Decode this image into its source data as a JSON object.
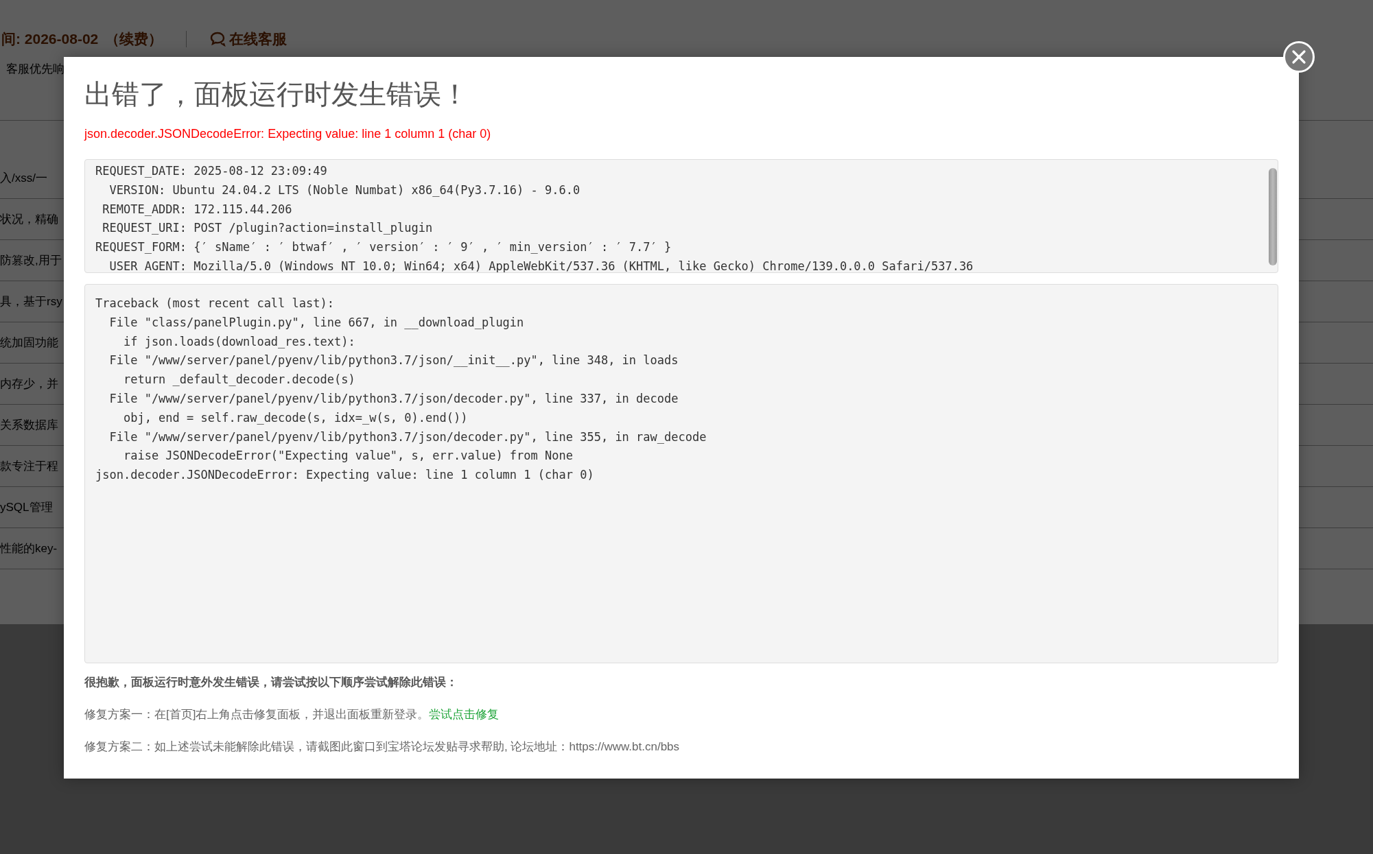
{
  "background_page": {
    "expiry_text": "间: 2026-08-02",
    "renew_link": "（续费）",
    "support_link": "在线客服",
    "notice": "客服优先响",
    "plugin_descriptions": [
      "入/xss/一",
      "状况，精确",
      "防篡改,用于",
      "具，基于rsy",
      "统加固功能",
      "内存少，并",
      "关系数据库",
      "款专注于程",
      "ySQL管理",
      "性能的key-"
    ]
  },
  "dialog": {
    "title": "出错了，面板运行时发生错误！",
    "error_message": "json.decoder.JSONDecodeError: Expecting value: line 1 column 1 (char 0)",
    "request_info": [
      "REQUEST_DATE: 2025-08-12 23:09:49",
      "  VERSION: Ubuntu 24.04.2 LTS (Noble Numbat) x86_64(Py3.7.16) - 9.6.0",
      " REMOTE_ADDR: 172.115.44.206",
      " REQUEST_URI: POST /plugin?action=install_plugin",
      "REQUEST_FORM: {′ sName′ : ′ btwaf′ , ′ version′ : ′ 9′ , ′ min_version′ : ′ 7.7′ }",
      "  USER_AGENT: Mozilla/5.0 (Windows NT 10.0; Win64; x64) AppleWebKit/537.36 (KHTML, like Gecko) Chrome/139.0.0.0 Safari/537.36"
    ],
    "traceback": [
      "Traceback (most recent call last):",
      "  File \"class/panelPlugin.py\", line 667, in __download_plugin",
      "    if json.loads(download_res.text):",
      "  File \"/www/server/panel/pyenv/lib/python3.7/json/__init__.py\", line 348, in loads",
      "    return _default_decoder.decode(s)",
      "  File \"/www/server/panel/pyenv/lib/python3.7/json/decoder.py\", line 337, in decode",
      "    obj, end = self.raw_decode(s, idx=_w(s, 0).end())",
      "  File \"/www/server/panel/pyenv/lib/python3.7/json/decoder.py\", line 355, in raw_decode",
      "    raise JSONDecodeError(\"Expecting value\", s, err.value) from None",
      "json.decoder.JSONDecodeError: Expecting value: line 1 column 1 (char 0)"
    ],
    "help_heading": "很抱歉，面板运行时意外发生错误，请尝试按以下顺序尝试解除此错误：",
    "fix_steps": [
      {
        "text": "修复方案一：在[首页]右上角点击修复面板，并退出面板重新登录。",
        "link": "尝试点击修复"
      },
      {
        "text": "修复方案二：如上述尝试未能解除此错误，请截图此窗口到宝塔论坛发贴寻求帮助, 论坛地址：https://www.bt.cn/bbs"
      }
    ]
  }
}
